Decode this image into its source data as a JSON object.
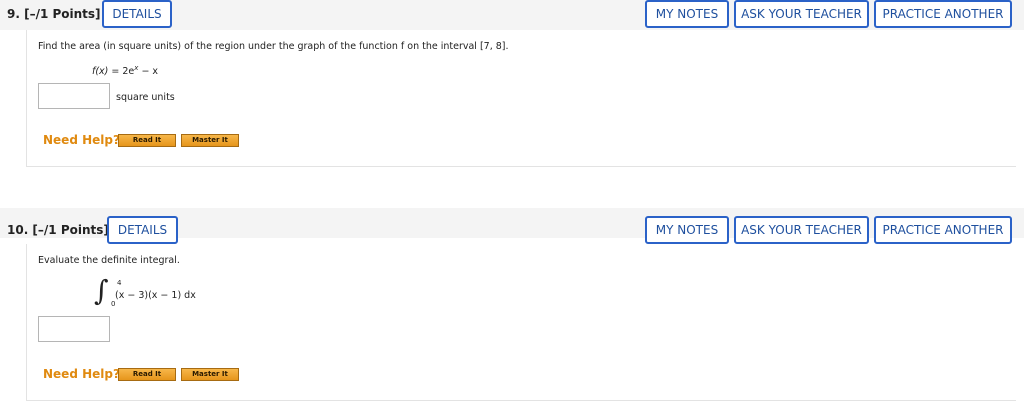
{
  "q9": {
    "label": "9.  [–/1 Points]",
    "details": "DETAILS",
    "my_notes": "MY NOTES",
    "ask_teacher": "ASK YOUR TEACHER",
    "practice": "PRACTICE ANOTHER",
    "prompt": "Find the area (in square units) of the region under the graph of the function f on the interval [7, 8].",
    "formula_lhs": "f(x)",
    "formula_eq": " = 2e",
    "formula_exp": "x",
    "formula_rest": " − x",
    "units": "square units",
    "answer": "",
    "need_help": "Need Help?",
    "read_it": "Read It",
    "master_it": "Master It"
  },
  "q10": {
    "label": "10.  [–/1 Points]",
    "details": "DETAILS",
    "my_notes": "MY NOTES",
    "ask_teacher": "ASK YOUR TEACHER",
    "practice": "PRACTICE ANOTHER",
    "prompt": "Evaluate the definite integral.",
    "integral_upper": "4",
    "integral_lower": "0",
    "integrand": "(x − 3)(x − 1) dx",
    "answer": "",
    "need_help": "Need Help?",
    "read_it": "Read It",
    "master_it": "Master It"
  }
}
